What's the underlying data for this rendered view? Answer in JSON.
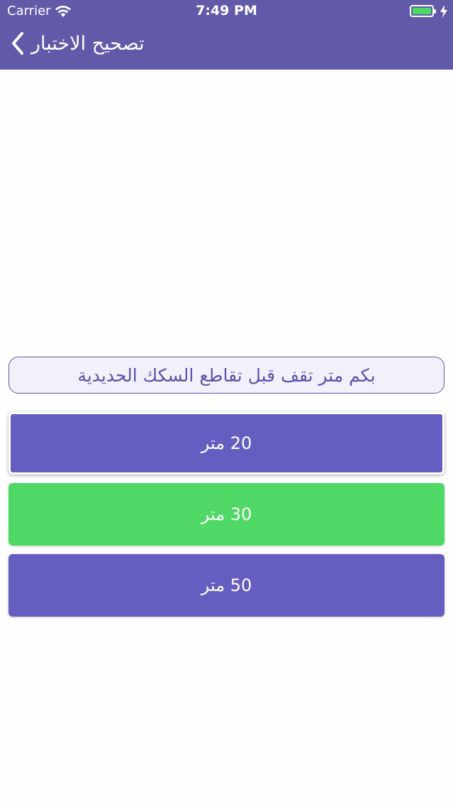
{
  "status_bar": {
    "carrier": "Carrier",
    "time": "7:49 PM",
    "battery_color": "#4cd964"
  },
  "nav": {
    "title": "تصحيح الاختبار",
    "back_icon": "chevron-left-icon"
  },
  "quiz": {
    "question": "بكم متر تقف قبل تقاطع السكك الحديدية",
    "answers": [
      {
        "label": "20 متر",
        "state": "selected",
        "color": "#655dbf"
      },
      {
        "label": "30 متر",
        "state": "correct",
        "color": "#4fd865"
      },
      {
        "label": "50 متر",
        "state": "default",
        "color": "#655dbf"
      }
    ]
  },
  "colors": {
    "header": "#615aa9",
    "accent": "#655dbf",
    "correct": "#4fd865"
  }
}
